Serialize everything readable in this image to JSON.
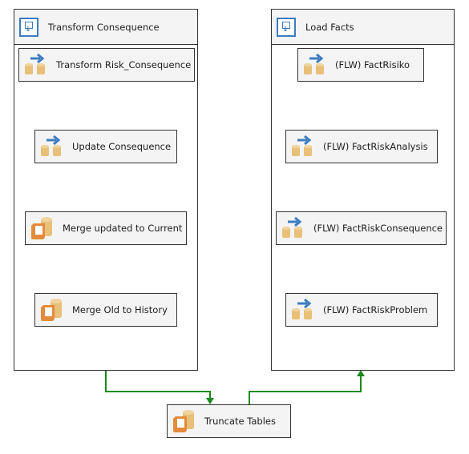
{
  "containers": [
    {
      "title": "Transform Consequence",
      "icon": "sequence-container-icon",
      "tasks": [
        {
          "label": "Transform Risk_Consequence",
          "icon": "data-flow-task-icon"
        },
        {
          "label": "Update Consequence",
          "icon": "data-flow-task-icon"
        },
        {
          "label": "Merge updated to Current",
          "icon": "execute-sql-task-icon"
        },
        {
          "label": "Merge Old to History",
          "icon": "execute-sql-task-icon"
        }
      ]
    },
    {
      "title": "Load Facts",
      "icon": "sequence-container-icon",
      "tasks": [
        {
          "label": "(FLW) FactRisiko",
          "icon": "data-flow-task-icon"
        },
        {
          "label": "(FLW) FactRiskAnalysis",
          "icon": "data-flow-task-icon"
        },
        {
          "label": "(FLW) FactRiskConsequence",
          "icon": "data-flow-task-icon"
        },
        {
          "label": "(FLW) FactRiskProblem",
          "icon": "data-flow-task-icon"
        }
      ]
    }
  ],
  "standalone": {
    "label": "Truncate Tables",
    "icon": "execute-sql-task-icon"
  },
  "colors": {
    "precedence_success": "#1a8a1a",
    "container_icon": "#3d7cc0",
    "db": "#e8c07a",
    "script": "#e48a3c"
  }
}
